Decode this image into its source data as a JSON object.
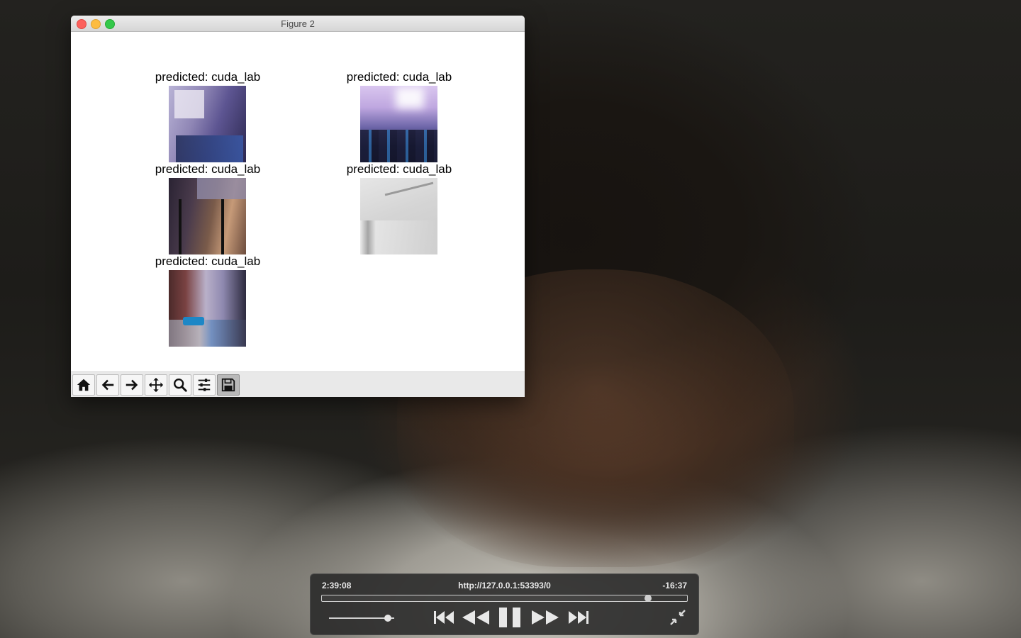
{
  "window": {
    "title": "Figure 2"
  },
  "subplots": [
    {
      "title": "predicted: cuda_lab"
    },
    {
      "title": "predicted: cuda_lab"
    },
    {
      "title": "predicted: cuda_lab"
    },
    {
      "title": "predicted: cuda_lab"
    },
    {
      "title": "predicted: cuda_lab"
    }
  ],
  "toolbar": {
    "buttons": [
      "home-icon",
      "back-arrow-icon",
      "forward-arrow-icon",
      "pan-move-icon",
      "zoom-magnifier-icon",
      "subplots-sliders-icon",
      "save-floppy-icon"
    ],
    "active": "save-floppy-icon"
  },
  "player": {
    "elapsed": "2:39:08",
    "url": "http://127.0.0.1:53393/0",
    "remaining": "-16:37",
    "progress": 0.89,
    "volume": 0.9,
    "icons": [
      "skip-back-icon",
      "rewind-icon",
      "pause-icon",
      "fast-forward-icon",
      "skip-forward-icon",
      "exit-fullscreen-icon"
    ]
  }
}
